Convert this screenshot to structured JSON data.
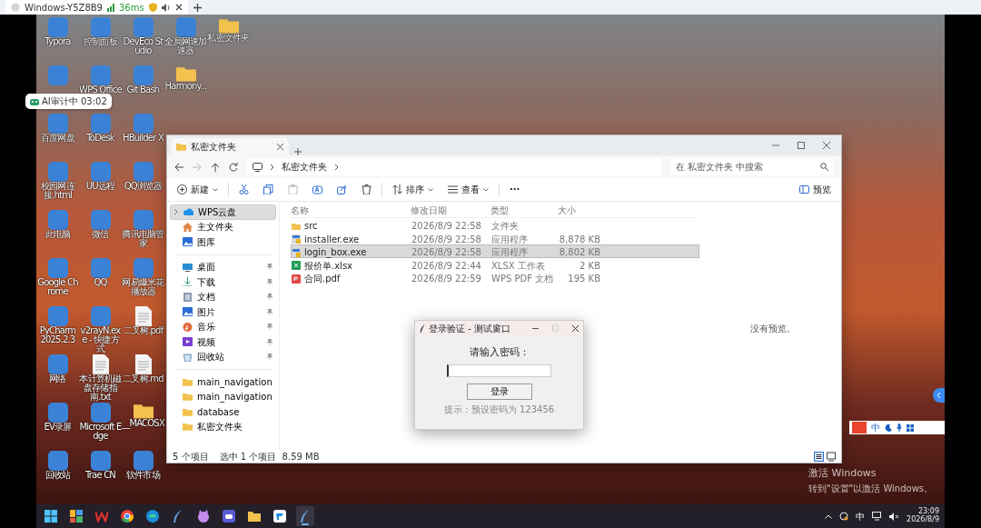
{
  "remote_session": {
    "title": "Windows-Y5Z8B9",
    "latency": "36ms"
  },
  "desktop": {
    "columns": [
      [
        {
          "kind": "app",
          "label": "Typora"
        },
        {
          "kind": "app"
        },
        {
          "kind": "app",
          "label": "百度网盘"
        },
        {
          "kind": "app",
          "label": "校园网连接.html"
        },
        {
          "kind": "app",
          "label": "此电脑"
        },
        {
          "kind": "app",
          "label": "Google Chrome"
        },
        {
          "kind": "app",
          "label": "PyCharm 2025.2.3"
        },
        {
          "kind": "app",
          "label": "网络"
        },
        {
          "kind": "app",
          "label": "EV录屏"
        },
        {
          "kind": "app",
          "label": "回收站"
        }
      ],
      [
        {
          "kind": "app",
          "label": "控制面板"
        },
        {
          "kind": "app",
          "label": "WPS Office"
        },
        {
          "kind": "app",
          "label": "ToDesk"
        },
        {
          "kind": "app",
          "label": "UU远程"
        },
        {
          "kind": "app",
          "label": "微信"
        },
        {
          "kind": "app",
          "label": "QQ"
        },
        {
          "kind": "app",
          "label": "v2rayN.exe - 快捷方式"
        },
        {
          "kind": "document",
          "label": "本计算机磁盘存储指南.txt"
        },
        {
          "kind": "app",
          "label": "Microsoft Edge"
        },
        {
          "kind": "app",
          "label": "Trae CN"
        }
      ],
      [
        {
          "kind": "app",
          "label": "DevEco Studio"
        },
        {
          "kind": "app",
          "label": "Git Bash"
        },
        {
          "kind": "app",
          "label": "HBuilder X"
        },
        {
          "kind": "app",
          "label": "QQ浏览器"
        },
        {
          "kind": "app",
          "label": "腾讯电脑管家"
        },
        {
          "kind": "app",
          "label": "网易爆米花播放器"
        },
        {
          "kind": "document",
          "label": "二叉树.pdf"
        },
        {
          "kind": "document",
          "label": "二叉树.md"
        },
        {
          "kind": "folder",
          "label": "__MACOSX"
        },
        {
          "kind": "app",
          "label": "软件市场"
        }
      ],
      [
        {
          "kind": "app",
          "label": "全局网速加速器"
        },
        {
          "kind": "folder",
          "label": "Harmony..."
        }
      ],
      [
        {
          "kind": "folder",
          "label": "私密文件夹"
        }
      ]
    ]
  },
  "audit_badge": {
    "text": "AI审计中 03:02"
  },
  "explorer": {
    "tab_title": "私密文件夹",
    "breadcrumb": "私密文件夹",
    "search_placeholder": "在 私密文件夹 中搜索",
    "toolbar": [
      {
        "kind": "new",
        "label": "新建",
        "disabled": false
      },
      {
        "kind": "cut",
        "disabled": false
      },
      {
        "kind": "copy",
        "disabled": false
      },
      {
        "kind": "paste",
        "disabled": true
      },
      {
        "kind": "rename",
        "disabled": false
      },
      {
        "kind": "share",
        "disabled": false
      },
      {
        "kind": "delete",
        "disabled": false
      },
      {
        "kind": "sort",
        "label": "排序",
        "disabled": false
      },
      {
        "kind": "view",
        "label": "查看",
        "disabled": false
      },
      {
        "kind": "more",
        "label": "···",
        "disabled": false
      }
    ],
    "preview_toggle": "预览",
    "sidebar": [
      {
        "kind": "cloud",
        "label": "WPS云盘",
        "selected": true,
        "pinned": false
      },
      {
        "kind": "home",
        "label": "主文件夹",
        "selected": false,
        "pinned": false
      },
      {
        "kind": "gallery",
        "label": "图库",
        "selected": false,
        "pinned": false
      },
      {
        "kind": "desktop",
        "label": "桌面",
        "selected": false,
        "pinned": true
      },
      {
        "kind": "download",
        "label": "下载",
        "selected": false,
        "pinned": true
      },
      {
        "kind": "documents",
        "label": "文档",
        "selected": false,
        "pinned": true
      },
      {
        "kind": "pictures",
        "label": "图片",
        "selected": false,
        "pinned": true
      },
      {
        "kind": "music",
        "label": "音乐",
        "selected": false,
        "pinned": true
      },
      {
        "kind": "videos",
        "label": "视频",
        "selected": false,
        "pinned": true
      },
      {
        "kind": "recycle",
        "label": "回收站",
        "selected": false,
        "pinned": true
      },
      {
        "kind": "folder",
        "label": "main_navigation",
        "selected": false,
        "pinned": false
      },
      {
        "kind": "folder",
        "label": "main_navigation",
        "selected": false,
        "pinned": false
      },
      {
        "kind": "folder",
        "label": "database",
        "selected": false,
        "pinned": false
      },
      {
        "kind": "folder",
        "label": "私密文件夹",
        "selected": false,
        "pinned": false
      }
    ],
    "columns": [
      "名称",
      "修改日期",
      "类型",
      "大小"
    ],
    "files": [
      {
        "kind": "folder",
        "name": "src",
        "modified": "2026/8/9 22:58",
        "type": "文件夹",
        "selected": false
      },
      {
        "kind": "exe",
        "name": "installer.exe",
        "modified": "2026/8/9 22:58",
        "type": "应用程序",
        "size": "8,878 KB",
        "selected": false
      },
      {
        "kind": "exe",
        "name": "login_box.exe",
        "modified": "2026/8/9 22:58",
        "type": "应用程序",
        "size": "8,802 KB",
        "selected": true
      },
      {
        "kind": "xlsx",
        "name": "报价单.xlsx",
        "modified": "2026/8/9 22:44",
        "type": "XLSX 工作表",
        "size": "2 KB",
        "selected": false
      },
      {
        "kind": "pdf",
        "name": "合同.pdf",
        "modified": "2026/8/9 22:59",
        "type": "WPS PDF 文档",
        "size": "195 KB",
        "selected": false
      }
    ],
    "preview_text": "没有预览。",
    "status_count": "5 个项目",
    "status_selection": "选中 1 个项目  8.59 MB"
  },
  "login_dialog": {
    "title": "登录验证 - 测试窗口",
    "prompt": "请输入密码：",
    "button": "登录",
    "hint": "提示：预设密码为 123456"
  },
  "ime_bar": {
    "mode": "中"
  },
  "activation_notice": {
    "title": "激活 Windows",
    "text": "转到\"设置\"以激活 Windows。"
  },
  "taskbar": {
    "apps": [
      {
        "kind": "start",
        "active": false
      },
      {
        "kind": "widgets",
        "active": false
      },
      {
        "kind": "wps",
        "active": false
      },
      {
        "kind": "chrome",
        "active": false
      },
      {
        "kind": "edge",
        "active": false
      },
      {
        "kind": "feather",
        "active": false
      },
      {
        "kind": "cat",
        "active": false
      },
      {
        "kind": "robot",
        "active": false
      },
      {
        "kind": "folder",
        "active": false
      },
      {
        "kind": "todesk",
        "active": false
      },
      {
        "kind": "feather",
        "active": true
      }
    ],
    "ime": "中",
    "time": "23:09",
    "date": "2026/8/9"
  }
}
